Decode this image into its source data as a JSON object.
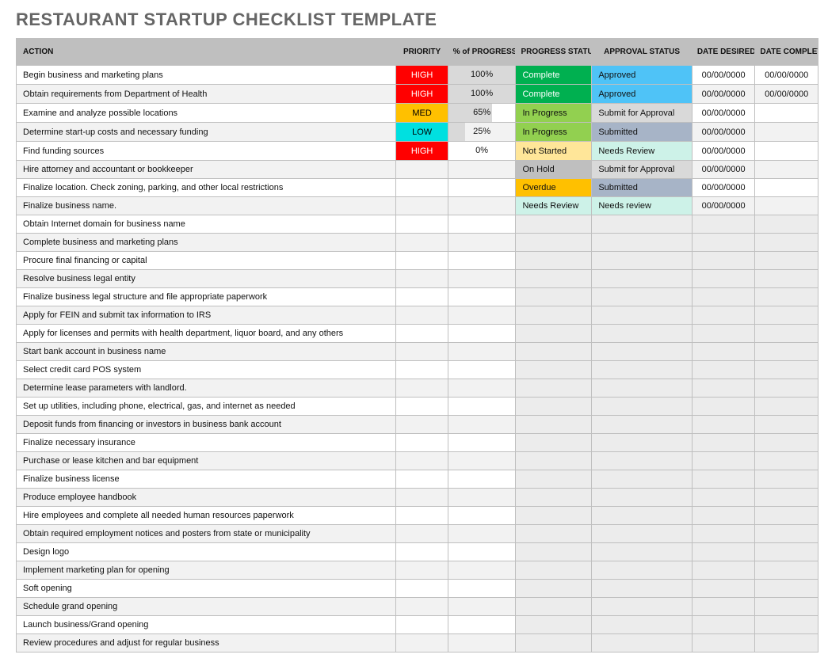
{
  "title": "RESTAURANT STARTUP CHECKLIST TEMPLATE",
  "headers": {
    "action": "ACTION",
    "priority": "PRIORITY",
    "progress": "% of PROGRESS",
    "progress_status": "PROGRESS STATUS",
    "approval_status": "APPROVAL STATUS",
    "date_desired": "DATE DESIRED",
    "date_completed": "DATE COMPLETED"
  },
  "rows": [
    {
      "action": "Begin business and marketing plans",
      "priority": "HIGH",
      "progress": 100,
      "progress_label": "100%",
      "progress_status": "Complete",
      "approval_status": "Approved",
      "date_desired": "00/00/0000",
      "date_completed": "00/00/0000"
    },
    {
      "action": "Obtain requirements from Department of Health",
      "priority": "HIGH",
      "progress": 100,
      "progress_label": "100%",
      "progress_status": "Complete",
      "approval_status": "Approved",
      "date_desired": "00/00/0000",
      "date_completed": "00/00/0000"
    },
    {
      "action": "Examine and analyze possible locations",
      "priority": "MED",
      "progress": 65,
      "progress_label": "65%",
      "progress_status": "In Progress",
      "approval_status": "Submit for Approval",
      "date_desired": "00/00/0000",
      "date_completed": ""
    },
    {
      "action": "Determine start-up costs and necessary funding",
      "priority": "LOW",
      "progress": 25,
      "progress_label": "25%",
      "progress_status": "In Progress",
      "approval_status": "Submitted",
      "date_desired": "00/00/0000",
      "date_completed": ""
    },
    {
      "action": "Find funding sources",
      "priority": "HIGH",
      "progress": 0,
      "progress_label": "0%",
      "progress_status": "Not Started",
      "approval_status": "Needs Review",
      "date_desired": "00/00/0000",
      "date_completed": ""
    },
    {
      "action": "Hire attorney and accountant or bookkeeper",
      "priority": "",
      "progress": null,
      "progress_label": "",
      "progress_status": "On Hold",
      "approval_status": "Submit for Approval",
      "date_desired": "00/00/0000",
      "date_completed": ""
    },
    {
      "action": "Finalize location. Check zoning, parking, and other local restrictions",
      "priority": "",
      "progress": null,
      "progress_label": "",
      "progress_status": "Overdue",
      "approval_status": "Submitted",
      "date_desired": "00/00/0000",
      "date_completed": ""
    },
    {
      "action": "Finalize business name.",
      "priority": "",
      "progress": null,
      "progress_label": "",
      "progress_status": "Needs Review",
      "approval_status": "Needs review",
      "date_desired": "00/00/0000",
      "date_completed": ""
    },
    {
      "action": "Obtain Internet domain for business name"
    },
    {
      "action": "Complete business and marketing plans"
    },
    {
      "action": "Procure final financing or capital"
    },
    {
      "action": "Resolve business legal entity"
    },
    {
      "action": "Finalize business legal structure and file appropriate paperwork"
    },
    {
      "action": "Apply for FEIN and submit tax information to IRS"
    },
    {
      "action": "Apply for licenses and permits with health department, liquor board, and any others"
    },
    {
      "action": "Start bank account in business name"
    },
    {
      "action": "Select credit card POS system"
    },
    {
      "action": "Determine lease parameters with landlord."
    },
    {
      "action": "Set up utilities, including phone, electrical, gas, and internet as needed"
    },
    {
      "action": "Deposit funds from financing or investors in business bank account"
    },
    {
      "action": "Finalize necessary insurance"
    },
    {
      "action": "Purchase or lease kitchen and bar equipment"
    },
    {
      "action": "Finalize business license"
    },
    {
      "action": "Produce employee handbook"
    },
    {
      "action": "Hire employees and complete all needed human resources paperwork"
    },
    {
      "action": "Obtain required employment notices and posters from state or municipality"
    },
    {
      "action": "Design logo"
    },
    {
      "action": "Implement marketing plan for opening"
    },
    {
      "action": "Soft opening"
    },
    {
      "action": "Schedule grand opening"
    },
    {
      "action": "Launch business/Grand opening"
    },
    {
      "action": "Review procedures and adjust for regular business"
    }
  ],
  "status_classes": {
    "progress": {
      "Complete": "ps-complete",
      "In Progress": "ps-inprogress",
      "Not Started": "ps-notstarted",
      "On Hold": "ps-onhold",
      "Overdue": "ps-overdue",
      "Needs Review": "ps-needsreview"
    },
    "approval": {
      "Approved": "ap-approved",
      "Submit for Approval": "ap-submit",
      "Submitted": "ap-submitted",
      "Needs Review": "ap-needsreview",
      "Needs review": "ap-needsreview"
    }
  }
}
